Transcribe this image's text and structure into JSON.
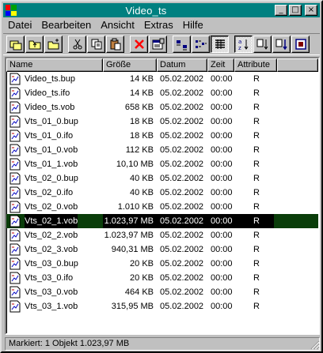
{
  "window": {
    "title": "Video_ts"
  },
  "titlebar_buttons": {
    "minimize": "_",
    "maximize": "□",
    "close": "×"
  },
  "menu": [
    "Datei",
    "Bearbeiten",
    "Ansicht",
    "Extras",
    "Hilfe"
  ],
  "toolbar": [
    {
      "name": "copy-disk-icon"
    },
    {
      "name": "up-folder-icon"
    },
    {
      "name": "new-folder-icon"
    },
    {
      "name": "sep"
    },
    {
      "name": "cut-icon"
    },
    {
      "name": "copy-icon"
    },
    {
      "name": "paste-icon"
    },
    {
      "name": "sep"
    },
    {
      "name": "delete-icon"
    },
    {
      "name": "properties-icon"
    },
    {
      "name": "sep"
    },
    {
      "name": "large-icons-icon"
    },
    {
      "name": "small-icons-icon"
    },
    {
      "name": "details-view-icon",
      "pressed": true
    },
    {
      "name": "sep"
    },
    {
      "name": "sort-ascending-icon",
      "pressed": true
    },
    {
      "name": "sort-descending-icon"
    },
    {
      "name": "move-icon"
    },
    {
      "name": "info-icon"
    }
  ],
  "columns": {
    "name": "Name",
    "size": "Größe",
    "date": "Datum",
    "time": "Zeit",
    "attr": "Attribute"
  },
  "files": [
    {
      "name": "Video_ts.bup",
      "size": "14 KB",
      "date": "05.02.2002",
      "time": "00:00",
      "attr": "R"
    },
    {
      "name": "Video_ts.ifo",
      "size": "14 KB",
      "date": "05.02.2002",
      "time": "00:00",
      "attr": "R"
    },
    {
      "name": "Video_ts.vob",
      "size": "658 KB",
      "date": "05.02.2002",
      "time": "00:00",
      "attr": "R"
    },
    {
      "name": "Vts_01_0.bup",
      "size": "18 KB",
      "date": "05.02.2002",
      "time": "00:00",
      "attr": "R"
    },
    {
      "name": "Vts_01_0.ifo",
      "size": "18 KB",
      "date": "05.02.2002",
      "time": "00:00",
      "attr": "R"
    },
    {
      "name": "Vts_01_0.vob",
      "size": "112 KB",
      "date": "05.02.2002",
      "time": "00:00",
      "attr": "R"
    },
    {
      "name": "Vts_01_1.vob",
      "size": "10,10 MB",
      "date": "05.02.2002",
      "time": "00:00",
      "attr": "R"
    },
    {
      "name": "Vts_02_0.bup",
      "size": "40 KB",
      "date": "05.02.2002",
      "time": "00:00",
      "attr": "R"
    },
    {
      "name": "Vts_02_0.ifo",
      "size": "40 KB",
      "date": "05.02.2002",
      "time": "00:00",
      "attr": "R"
    },
    {
      "name": "Vts_02_0.vob",
      "size": "1.010 KB",
      "date": "05.02.2002",
      "time": "00:00",
      "attr": "R"
    },
    {
      "name": "Vts_02_1.vob",
      "size": "1.023,97 MB",
      "date": "05.02.2002",
      "time": "00:00",
      "attr": "R",
      "selected": true
    },
    {
      "name": "Vts_02_2.vob",
      "size": "1.023,97 MB",
      "date": "05.02.2002",
      "time": "00:00",
      "attr": "R"
    },
    {
      "name": "Vts_02_3.vob",
      "size": "940,31 MB",
      "date": "05.02.2002",
      "time": "00:00",
      "attr": "R"
    },
    {
      "name": "Vts_03_0.bup",
      "size": "20 KB",
      "date": "05.02.2002",
      "time": "00:00",
      "attr": "R"
    },
    {
      "name": "Vts_03_0.ifo",
      "size": "20 KB",
      "date": "05.02.2002",
      "time": "00:00",
      "attr": "R"
    },
    {
      "name": "Vts_03_0.vob",
      "size": "464 KB",
      "date": "05.02.2002",
      "time": "00:00",
      "attr": "R"
    },
    {
      "name": "Vts_03_1.vob",
      "size": "315,95 MB",
      "date": "05.02.2002",
      "time": "00:00",
      "attr": "R"
    }
  ],
  "status": {
    "text": "Markiert: 1 Objekt 1.023,97 MB"
  },
  "colors": {
    "titlebar": "#008080",
    "selection": "#0a3d0a",
    "face": "#c0c0c0"
  }
}
